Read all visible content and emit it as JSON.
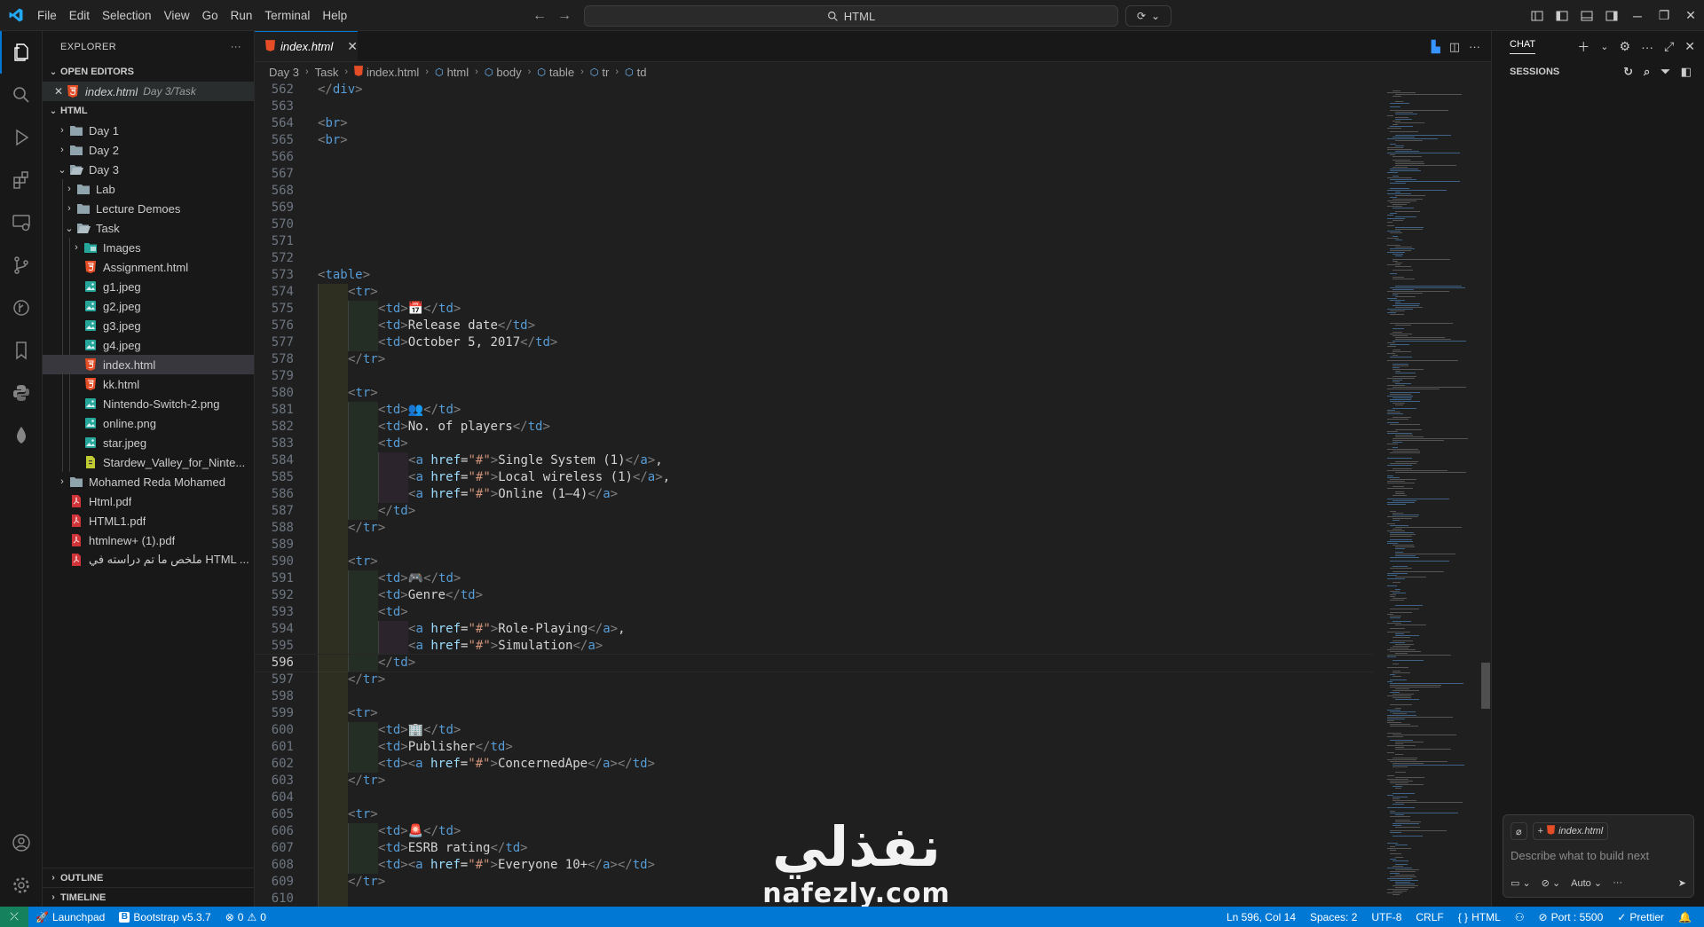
{
  "menu": [
    "File",
    "Edit",
    "Selection",
    "View",
    "Go",
    "Run",
    "Terminal",
    "Help"
  ],
  "command_center": {
    "text": "HTML"
  },
  "explorer": {
    "title": "EXPLORER",
    "open_editors_label": "OPEN EDITORS",
    "open_editor": {
      "name": "index.html",
      "path": "Day 3/Task"
    },
    "root_label": "HTML",
    "tree": [
      {
        "label": "Day 1",
        "type": "folder",
        "depth": 1,
        "expanded": false
      },
      {
        "label": "Day 2",
        "type": "folder",
        "depth": 1,
        "expanded": false
      },
      {
        "label": "Day 3",
        "type": "folder",
        "depth": 1,
        "expanded": true
      },
      {
        "label": "Lab",
        "type": "folder",
        "depth": 2,
        "expanded": false
      },
      {
        "label": "Lecture Demoes",
        "type": "folder",
        "depth": 2,
        "expanded": false
      },
      {
        "label": "Task",
        "type": "folder",
        "depth": 2,
        "expanded": true
      },
      {
        "label": "Images",
        "type": "folder-img",
        "depth": 3,
        "expanded": false
      },
      {
        "label": "Assignment.html",
        "type": "html",
        "depth": 3
      },
      {
        "label": "g1.jpeg",
        "type": "image",
        "depth": 3
      },
      {
        "label": "g2.jpeg",
        "type": "image",
        "depth": 3
      },
      {
        "label": "g3.jpeg",
        "type": "image",
        "depth": 3
      },
      {
        "label": "g4.jpeg",
        "type": "image",
        "depth": 3
      },
      {
        "label": "index.html",
        "type": "html",
        "depth": 3,
        "selected": true
      },
      {
        "label": "kk.html",
        "type": "html",
        "depth": 3
      },
      {
        "label": "Nintendo-Switch-2.png",
        "type": "image",
        "depth": 3
      },
      {
        "label": "online.png",
        "type": "image",
        "depth": 3
      },
      {
        "label": "star.jpeg",
        "type": "image",
        "depth": 3
      },
      {
        "label": "Stardew_Valley_for_Ninte...",
        "type": "generic",
        "depth": 3
      },
      {
        "label": "Mohamed Reda Mohamed",
        "type": "folder",
        "depth": 1,
        "expanded": false
      },
      {
        "label": "Html.pdf",
        "type": "pdf",
        "depth": 1
      },
      {
        "label": "HTML1.pdf",
        "type": "pdf",
        "depth": 1
      },
      {
        "label": "htmlnew+ (1).pdf",
        "type": "pdf",
        "depth": 1
      },
      {
        "label": "ملخص ما تم دراسته في HTML ...",
        "type": "pdf",
        "depth": 1
      }
    ],
    "outline_label": "OUTLINE",
    "timeline_label": "TIMELINE"
  },
  "editor": {
    "tab": {
      "name": "index.html"
    },
    "breadcrumb": [
      "Day 3",
      "Task",
      "index.html",
      "html",
      "body",
      "table",
      "tr",
      "td"
    ],
    "current_line": 596,
    "lines": [
      {
        "n": 562,
        "t": "</div>",
        "d": 0
      },
      {
        "n": 563,
        "t": "",
        "d": 0
      },
      {
        "n": 564,
        "t": "<br>",
        "d": 0
      },
      {
        "n": 565,
        "t": "<br>",
        "d": 0
      },
      {
        "n": 566,
        "t": "",
        "d": 0
      },
      {
        "n": 567,
        "t": "",
        "d": 0
      },
      {
        "n": 568,
        "t": "",
        "d": 0
      },
      {
        "n": 569,
        "t": "",
        "d": 0
      },
      {
        "n": 570,
        "t": "",
        "d": 0
      },
      {
        "n": 571,
        "t": "",
        "d": 0
      },
      {
        "n": 572,
        "t": "",
        "d": 0
      },
      {
        "n": 573,
        "t": "<table>",
        "d": 0
      },
      {
        "n": 574,
        "t": "<tr>",
        "d": 1
      },
      {
        "n": 575,
        "t": "<td>📅</td>",
        "d": 2
      },
      {
        "n": 576,
        "t": "<td>Release date</td>",
        "d": 2
      },
      {
        "n": 577,
        "t": "<td>October 5, 2017</td>",
        "d": 2
      },
      {
        "n": 578,
        "t": "</tr>",
        "d": 1
      },
      {
        "n": 579,
        "t": "",
        "d": 1
      },
      {
        "n": 580,
        "t": "<tr>",
        "d": 1
      },
      {
        "n": 581,
        "t": "<td>👥</td>",
        "d": 2
      },
      {
        "n": 582,
        "t": "<td>No. of players</td>",
        "d": 2
      },
      {
        "n": 583,
        "t": "<td>",
        "d": 2
      },
      {
        "n": 584,
        "t": "<a href=\"#\">Single System (1)</a>,",
        "d": 3
      },
      {
        "n": 585,
        "t": "<a href=\"#\">Local wireless (1)</a>,",
        "d": 3
      },
      {
        "n": 586,
        "t": "<a href=\"#\">Online (1–4)</a>",
        "d": 3
      },
      {
        "n": 587,
        "t": "</td>",
        "d": 2
      },
      {
        "n": 588,
        "t": "</tr>",
        "d": 1
      },
      {
        "n": 589,
        "t": "",
        "d": 1
      },
      {
        "n": 590,
        "t": "<tr>",
        "d": 1
      },
      {
        "n": 591,
        "t": "<td>🎮</td>",
        "d": 2
      },
      {
        "n": 592,
        "t": "<td>Genre</td>",
        "d": 2
      },
      {
        "n": 593,
        "t": "<td>",
        "d": 2
      },
      {
        "n": 594,
        "t": "<a href=\"#\">Role-Playing</a>,",
        "d": 3
      },
      {
        "n": 595,
        "t": "<a href=\"#\">Simulation</a>",
        "d": 3
      },
      {
        "n": 596,
        "t": "</td>",
        "d": 2
      },
      {
        "n": 597,
        "t": "</tr>",
        "d": 1
      },
      {
        "n": 598,
        "t": "",
        "d": 1
      },
      {
        "n": 599,
        "t": "<tr>",
        "d": 1
      },
      {
        "n": 600,
        "t": "<td>🏢</td>",
        "d": 2
      },
      {
        "n": 601,
        "t": "<td>Publisher</td>",
        "d": 2
      },
      {
        "n": 602,
        "t": "<td><a href=\"#\">ConcernedApe</a></td>",
        "d": 2
      },
      {
        "n": 603,
        "t": "</tr>",
        "d": 1
      },
      {
        "n": 604,
        "t": "",
        "d": 1
      },
      {
        "n": 605,
        "t": "<tr>",
        "d": 1
      },
      {
        "n": 606,
        "t": "<td>🚨</td>",
        "d": 2
      },
      {
        "n": 607,
        "t": "<td>ESRB rating</td>",
        "d": 2
      },
      {
        "n": 608,
        "t": "<td><a href=\"#\">Everyone 10+</a></td>",
        "d": 2
      },
      {
        "n": 609,
        "t": "</tr>",
        "d": 1
      },
      {
        "n": 610,
        "t": "",
        "d": 1
      }
    ]
  },
  "chat": {
    "title": "CHAT",
    "sessions_label": "SESSIONS",
    "context_file": "index.html",
    "placeholder": "Describe what to build next",
    "mode": "Auto"
  },
  "watermark": {
    "arabic": "نفذلي",
    "latin": "nafezly.com"
  },
  "status": {
    "launchpad": "Launchpad",
    "bootstrap": "Bootstrap v5.3.7",
    "errors": "0",
    "warnings": "0",
    "cursor": "Ln 596, Col 14",
    "spaces": "Spaces: 2",
    "encoding": "UTF-8",
    "eol": "CRLF",
    "language": "HTML",
    "port": "Port : 5500",
    "prettier": "Prettier"
  },
  "colors": {
    "accent": "#0078d4",
    "html_icon": "#e44d26",
    "pdf_icon": "#d13438",
    "tag": "#569cd6",
    "attr": "#9cdcfe",
    "string": "#ce9178"
  }
}
